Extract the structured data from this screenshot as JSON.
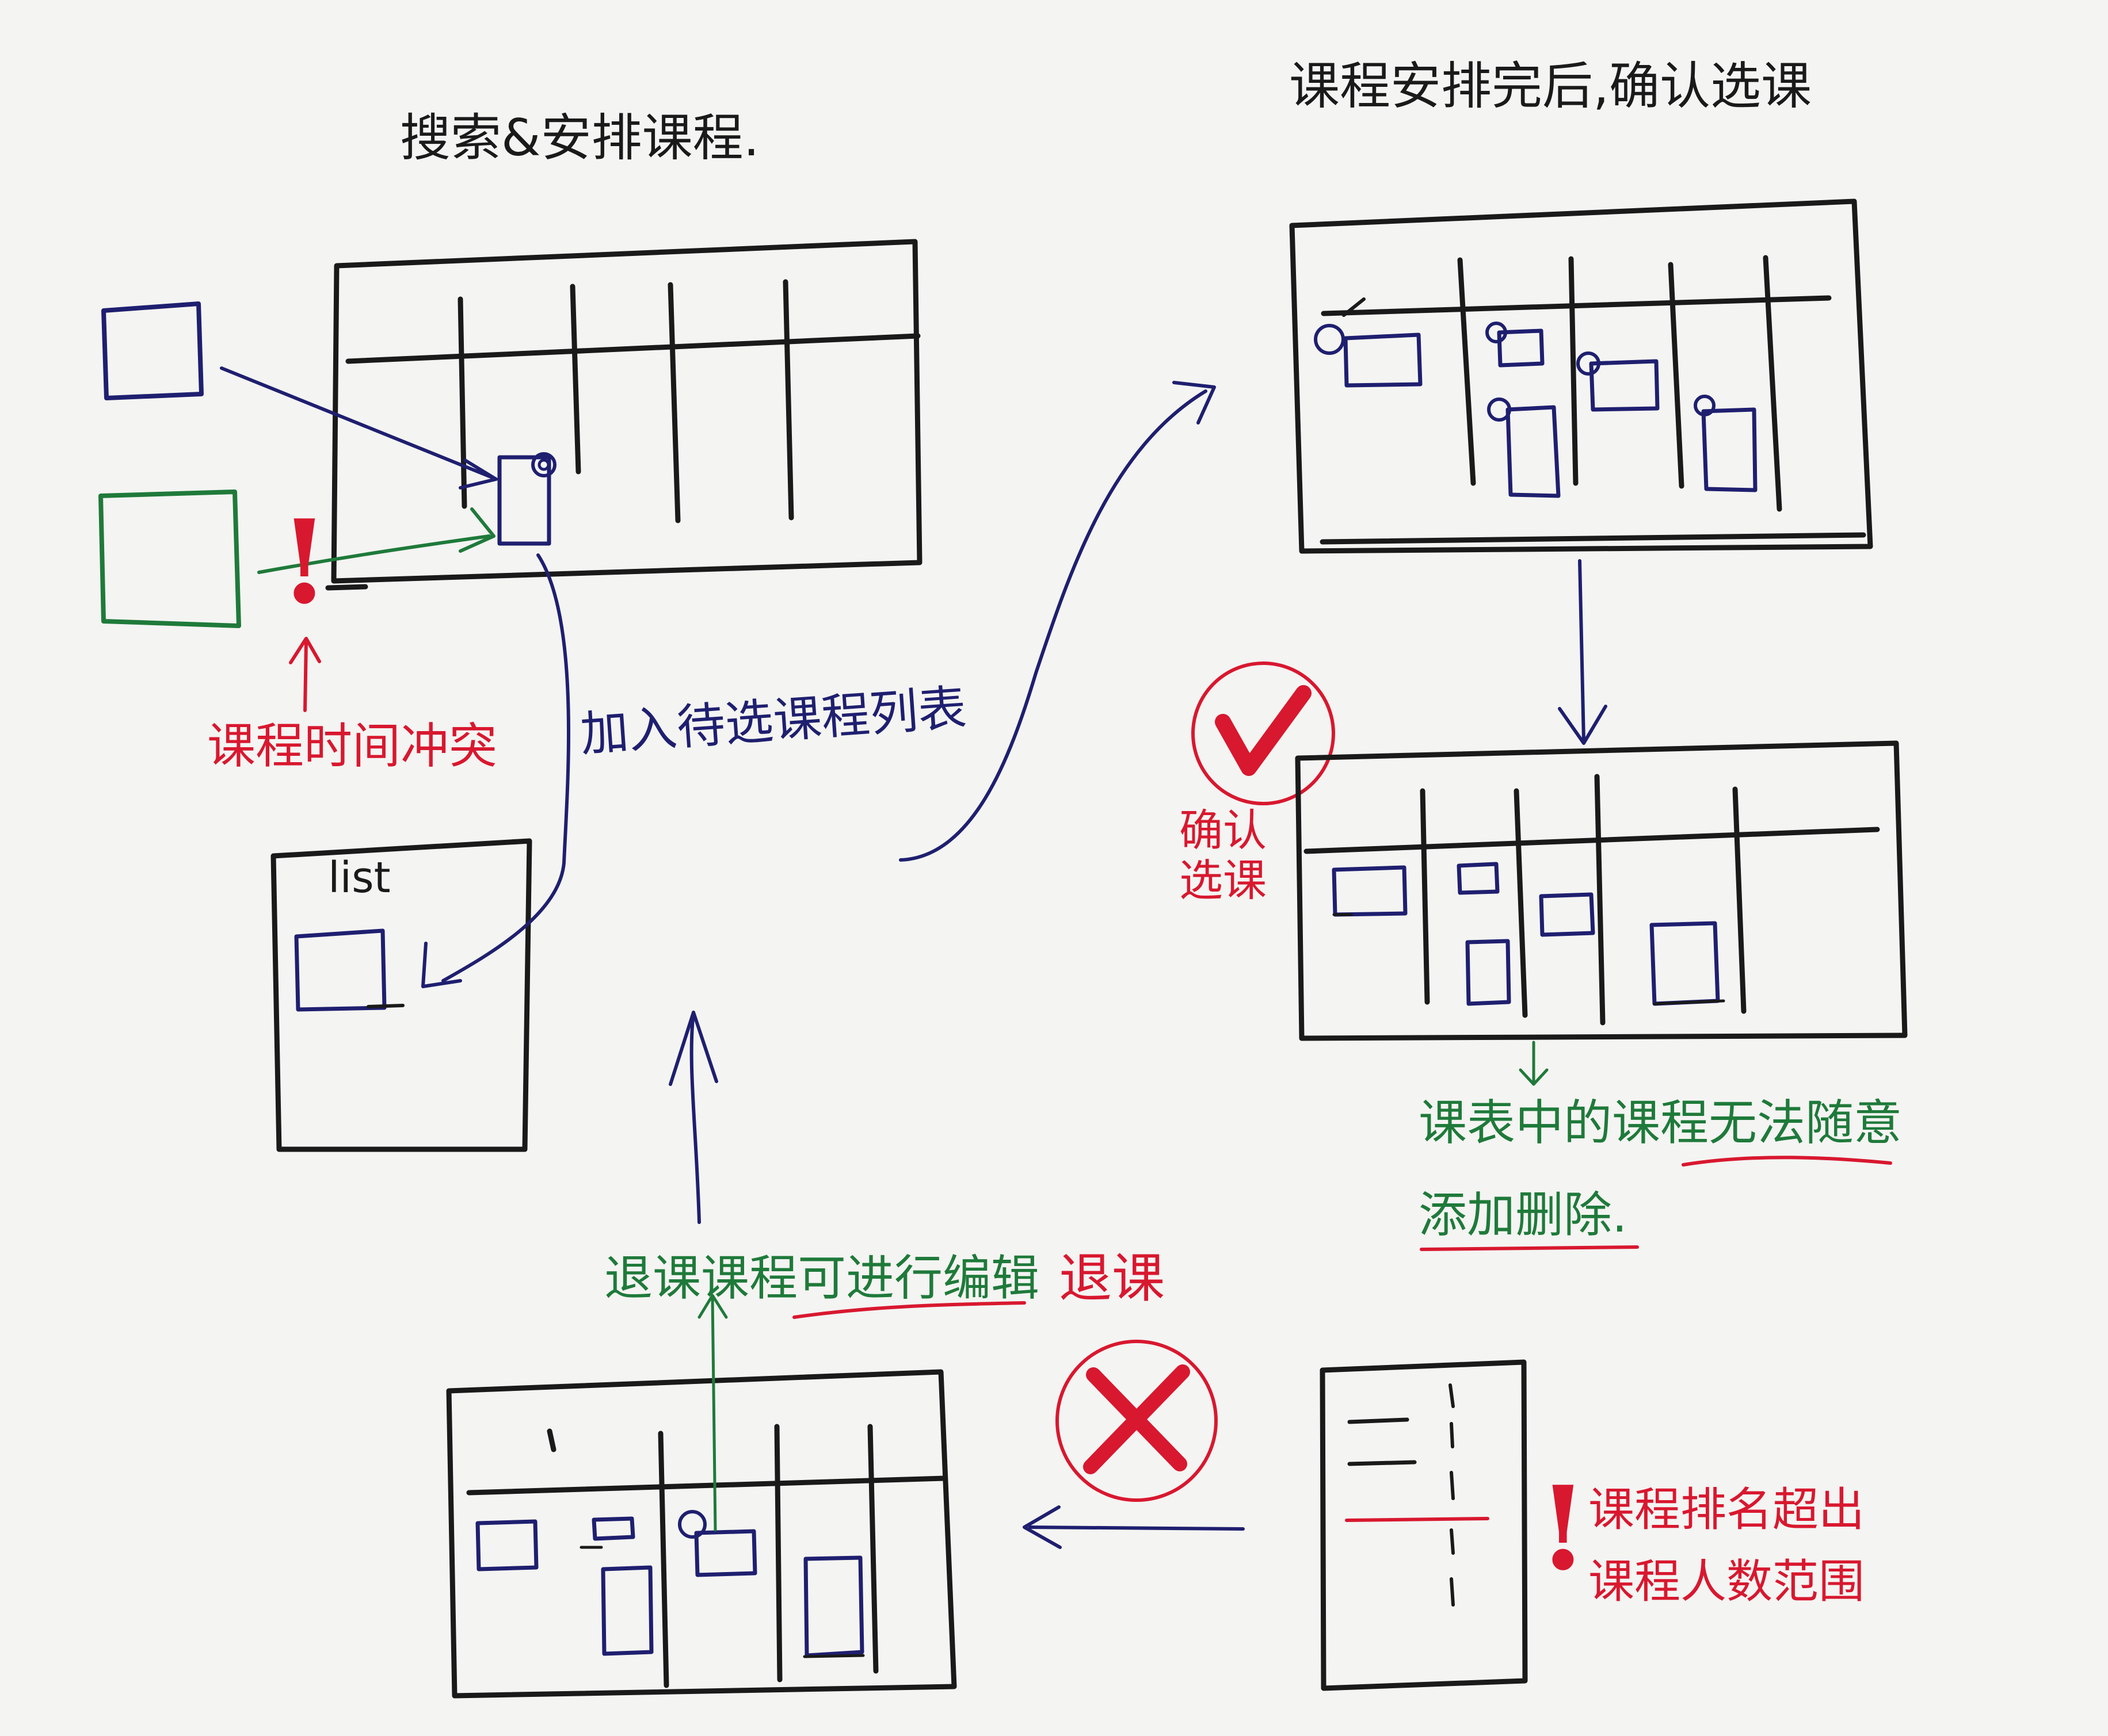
{
  "titles": {
    "search_arrange": "搜索&安排课程.",
    "after_arrange_confirm": "课程安排完后,确认选课"
  },
  "annotations": {
    "time_conflict": "课程时间冲突",
    "add_to_list": "加入待选课程列表",
    "list": "list",
    "confirm_selection": "确认选课",
    "cannot_freely_line1": "课表中的课程无法随意",
    "cannot_freely_line2": "添加删除.",
    "drop_edit": "退课课程可进行编辑",
    "drop": "退课",
    "over_capacity_line1": "课程排名超出",
    "over_capacity_line2": "课程人数范围"
  },
  "marks": {
    "warning_1": "!",
    "warning_2": "!"
  },
  "colors": {
    "ink": "#1a1a1a",
    "blue_ink": "#1f1f70",
    "green_ink": "#1f7a3a",
    "red_ink": "#d8182f",
    "paper": "#f4f4f2"
  }
}
